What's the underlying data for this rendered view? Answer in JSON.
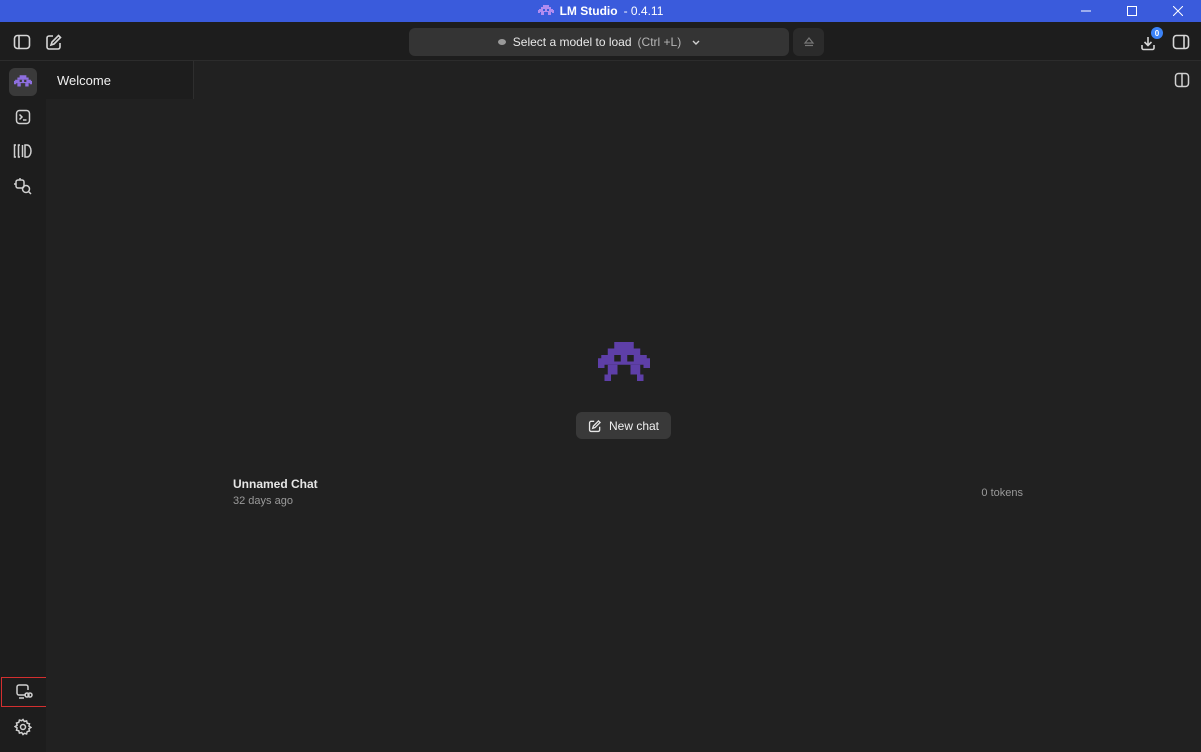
{
  "window": {
    "title_app": "LM Studio",
    "title_version": "- 0.4.11",
    "accent": "#3a5bdc"
  },
  "toolbar": {
    "model_select_label": "Select a model to load",
    "model_select_shortcut": "(Ctrl +L)",
    "downloads_badge": "0"
  },
  "tabs": [
    {
      "label": "Welcome"
    }
  ],
  "main": {
    "new_chat_label": "New chat",
    "chats": [
      {
        "name": "Unnamed Chat",
        "time": "32 days ago",
        "tokens": "0 tokens"
      }
    ]
  },
  "rail": {
    "items": [
      "chat-icon",
      "developer-icon",
      "models-icon",
      "discover-icon",
      "remote-link-icon",
      "settings-icon"
    ]
  }
}
